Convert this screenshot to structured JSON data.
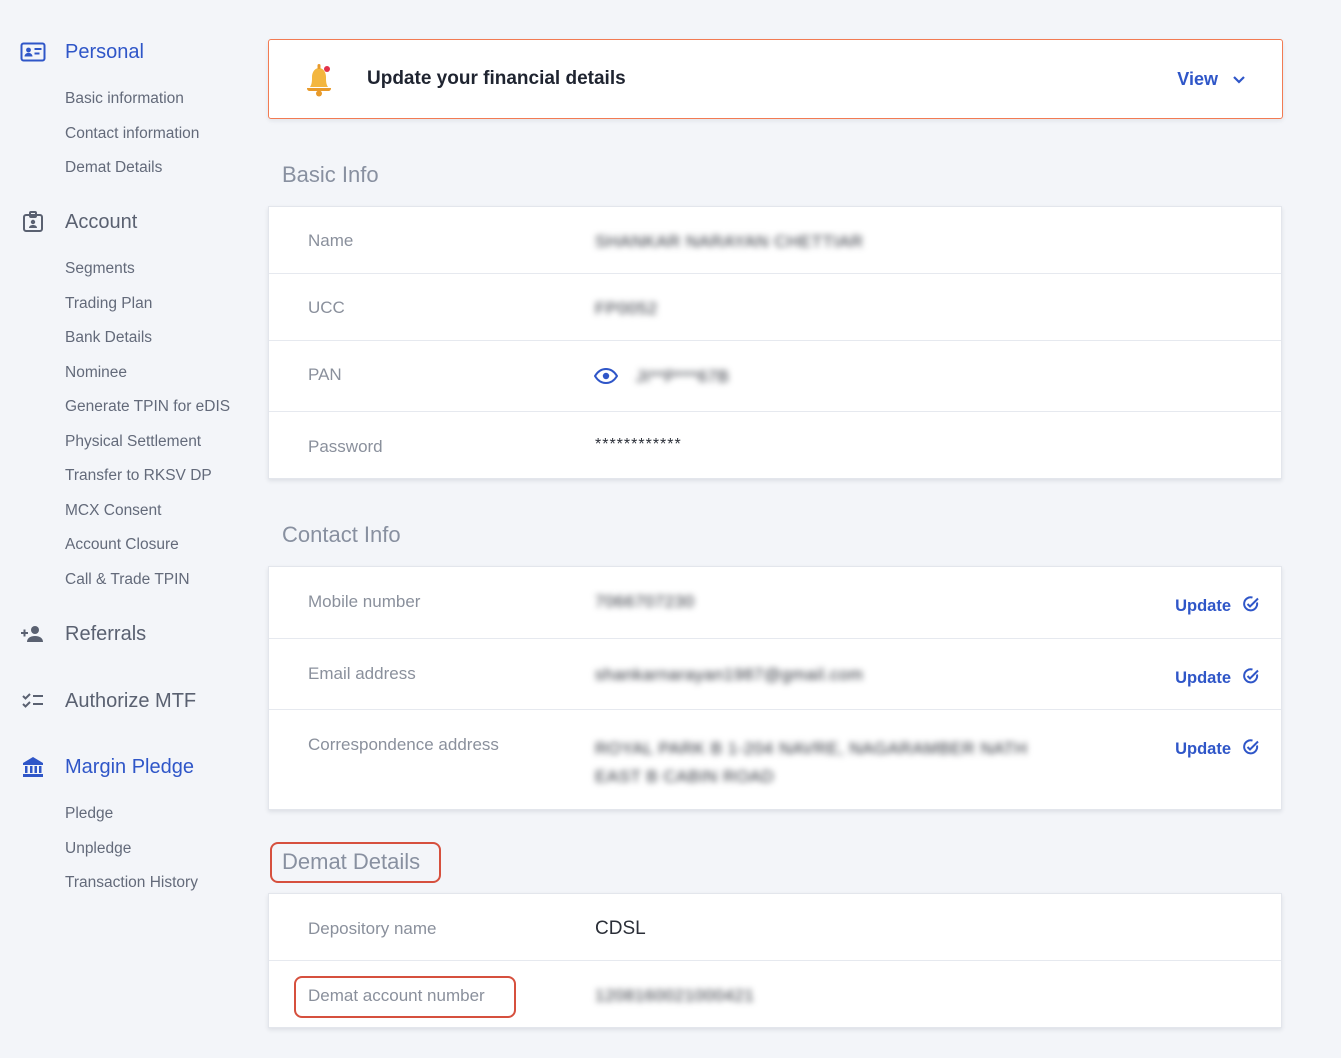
{
  "sidebar": {
    "personal": {
      "label": "Personal",
      "icon": "id-card-icon",
      "items": [
        "Basic information",
        "Contact information",
        "Demat Details"
      ]
    },
    "account": {
      "label": "Account",
      "icon": "briefcase-badge-icon",
      "items": [
        "Segments",
        "Trading Plan",
        "Bank Details",
        "Nominee",
        "Generate TPIN for eDIS",
        "Physical Settlement",
        "Transfer to RKSV DP",
        "MCX Consent",
        "Account Closure",
        "Call & Trade TPIN"
      ]
    },
    "referrals": {
      "label": "Referrals",
      "icon": "add-person-icon"
    },
    "authorize_mtf": {
      "label": "Authorize MTF",
      "icon": "checklist-icon"
    },
    "margin_pledge": {
      "label": "Margin Pledge",
      "icon": "bank-icon",
      "items": [
        "Pledge",
        "Unpledge",
        "Transaction History"
      ]
    }
  },
  "banner": {
    "title": "Update your financial details",
    "view_label": "View",
    "icon": "bell-icon"
  },
  "basic_info": {
    "title": "Basic Info",
    "rows": [
      {
        "label": "Name",
        "value": "SHANKAR NARAYAN CHETTIAR"
      },
      {
        "label": "UCC",
        "value": "FP0052"
      },
      {
        "label": "PAN",
        "value": "JI**P***67B"
      },
      {
        "label": "Password",
        "value": "************"
      }
    ]
  },
  "contact_info": {
    "title": "Contact Info",
    "update_label": "Update",
    "rows": [
      {
        "label": "Mobile number",
        "value": "7066707230"
      },
      {
        "label": "Email address",
        "value": "shankarnarayan1987@gmail.com"
      },
      {
        "label": "Correspondence address",
        "value_line1": "ROYAL PARK B 1-204 NAVRE, NAGARAMBER NATH",
        "value_line2": "EAST B CABIN ROAD"
      }
    ]
  },
  "demat_details": {
    "title": "Demat Details",
    "rows": [
      {
        "label": "Depository name",
        "value": "CDSL"
      },
      {
        "label": "Demat account number",
        "value": "1208160021000421"
      }
    ]
  },
  "colors": {
    "accent": "#2f56c8",
    "banner_border": "#f27b53",
    "highlight": "#d6503e"
  }
}
